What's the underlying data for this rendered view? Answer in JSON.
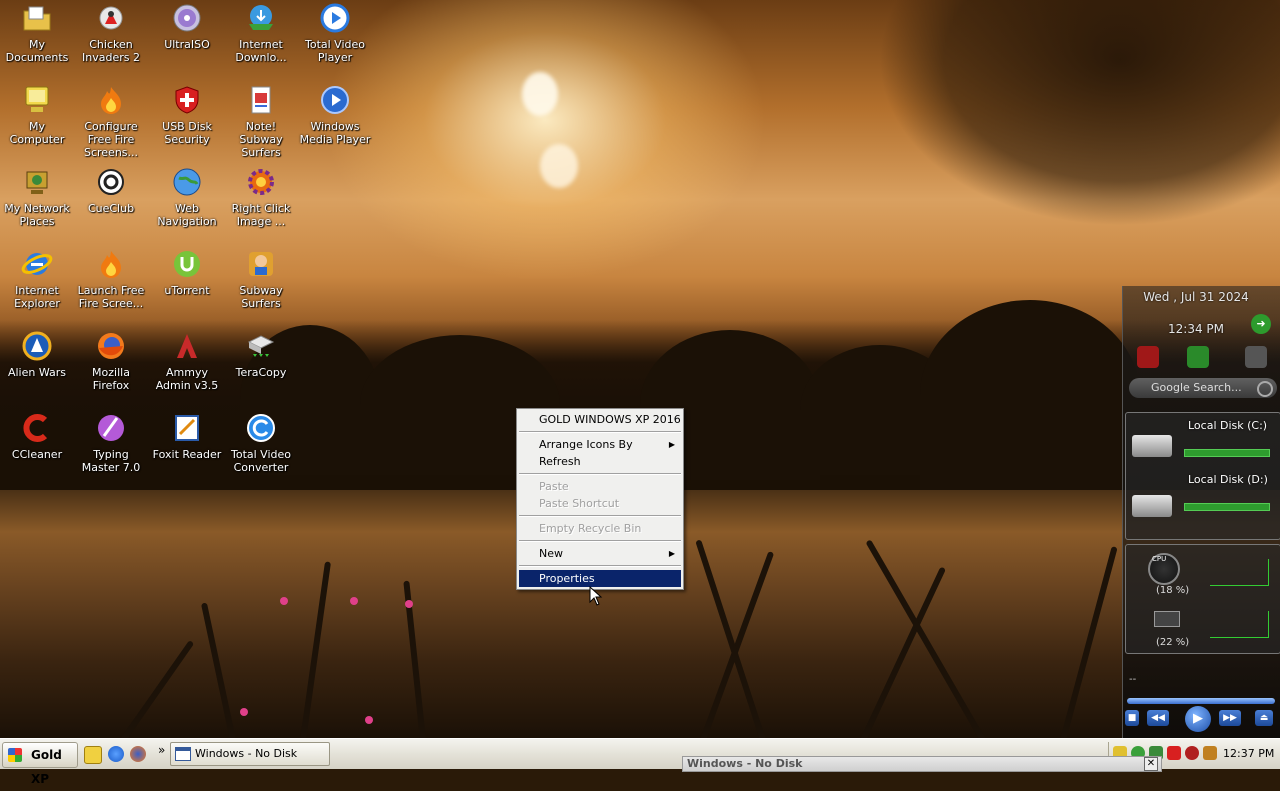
{
  "desktop_icons": [
    {
      "label": "My Documents",
      "icon": "folder-documents-icon"
    },
    {
      "label": "Chicken Invaders 2",
      "icon": "chicken-icon"
    },
    {
      "label": "UltraISO",
      "icon": "disc-icon"
    },
    {
      "label": "Internet Downlo...",
      "icon": "download-manager-icon"
    },
    {
      "label": "Total Video Player",
      "icon": "play-icon"
    },
    {
      "label": "My Computer",
      "icon": "computer-icon"
    },
    {
      "label": "Configure Free Fire Screens...",
      "icon": "fire-icon"
    },
    {
      "label": "USB Disk Security",
      "icon": "shield-icon"
    },
    {
      "label": "Note! Subway Surfers",
      "icon": "note-icon"
    },
    {
      "label": "Windows Media Player",
      "icon": "media-player-icon"
    },
    {
      "label": "My Network Places",
      "icon": "network-icon"
    },
    {
      "label": "CueClub",
      "icon": "cue-icon"
    },
    {
      "label": "Web Navigation",
      "icon": "globe-icon"
    },
    {
      "label": "Right Click Image ...",
      "icon": "gear-icon"
    },
    {
      "label": "Internet Explorer",
      "icon": "ie-icon"
    },
    {
      "label": "Launch Free Fire Scree...",
      "icon": "fire-icon"
    },
    {
      "label": "uTorrent",
      "icon": "utorrent-icon"
    },
    {
      "label": "Subway Surfers",
      "icon": "game-icon"
    },
    {
      "label": "Alien Wars",
      "icon": "alien-icon"
    },
    {
      "label": "Mozilla Firefox",
      "icon": "firefox-icon"
    },
    {
      "label": "Ammyy Admin v3.5",
      "icon": "ammyy-icon"
    },
    {
      "label": "TeraCopy",
      "icon": "copy-icon"
    },
    {
      "label": "CCleaner",
      "icon": "ccleaner-icon"
    },
    {
      "label": "Typing Master 7.0",
      "icon": "typing-icon"
    },
    {
      "label": "Foxit Reader",
      "icon": "pdf-icon"
    },
    {
      "label": "Total Video Converter",
      "icon": "converter-icon"
    }
  ],
  "context_menu": {
    "title": "GOLD WINDOWS XP 2016",
    "arrange": "Arrange Icons By",
    "refresh": "Refresh",
    "paste": "Paste",
    "paste_shortcut": "Paste Shortcut",
    "empty_recycle": "Empty Recycle Bin",
    "new": "New",
    "properties": "Properties",
    "submenu_arrow": "▶"
  },
  "sidebar": {
    "date": "Wed , Jul 31 2024",
    "time": "12:34 PM",
    "search_placeholder": "Google Search...",
    "disk_c": "Local Disk (C:)",
    "disk_d": "Local Disk (D:)",
    "cpu_label": "CPU",
    "cpu_pct": "(18 %)",
    "mem_pct": "(22 %)",
    "player_text": "--"
  },
  "taskbar": {
    "start_label": "Gold XP",
    "quicklaunch_more": "»",
    "task_window": "Windows - No Disk",
    "clock": "12:37 PM"
  },
  "ghost_window": {
    "title": "Windows - No Disk",
    "close": "✕"
  },
  "colors": {
    "menu_selected": "#0a246a",
    "disk_bar": "#2e9c2e",
    "taskbar": "#e4e2d8"
  }
}
